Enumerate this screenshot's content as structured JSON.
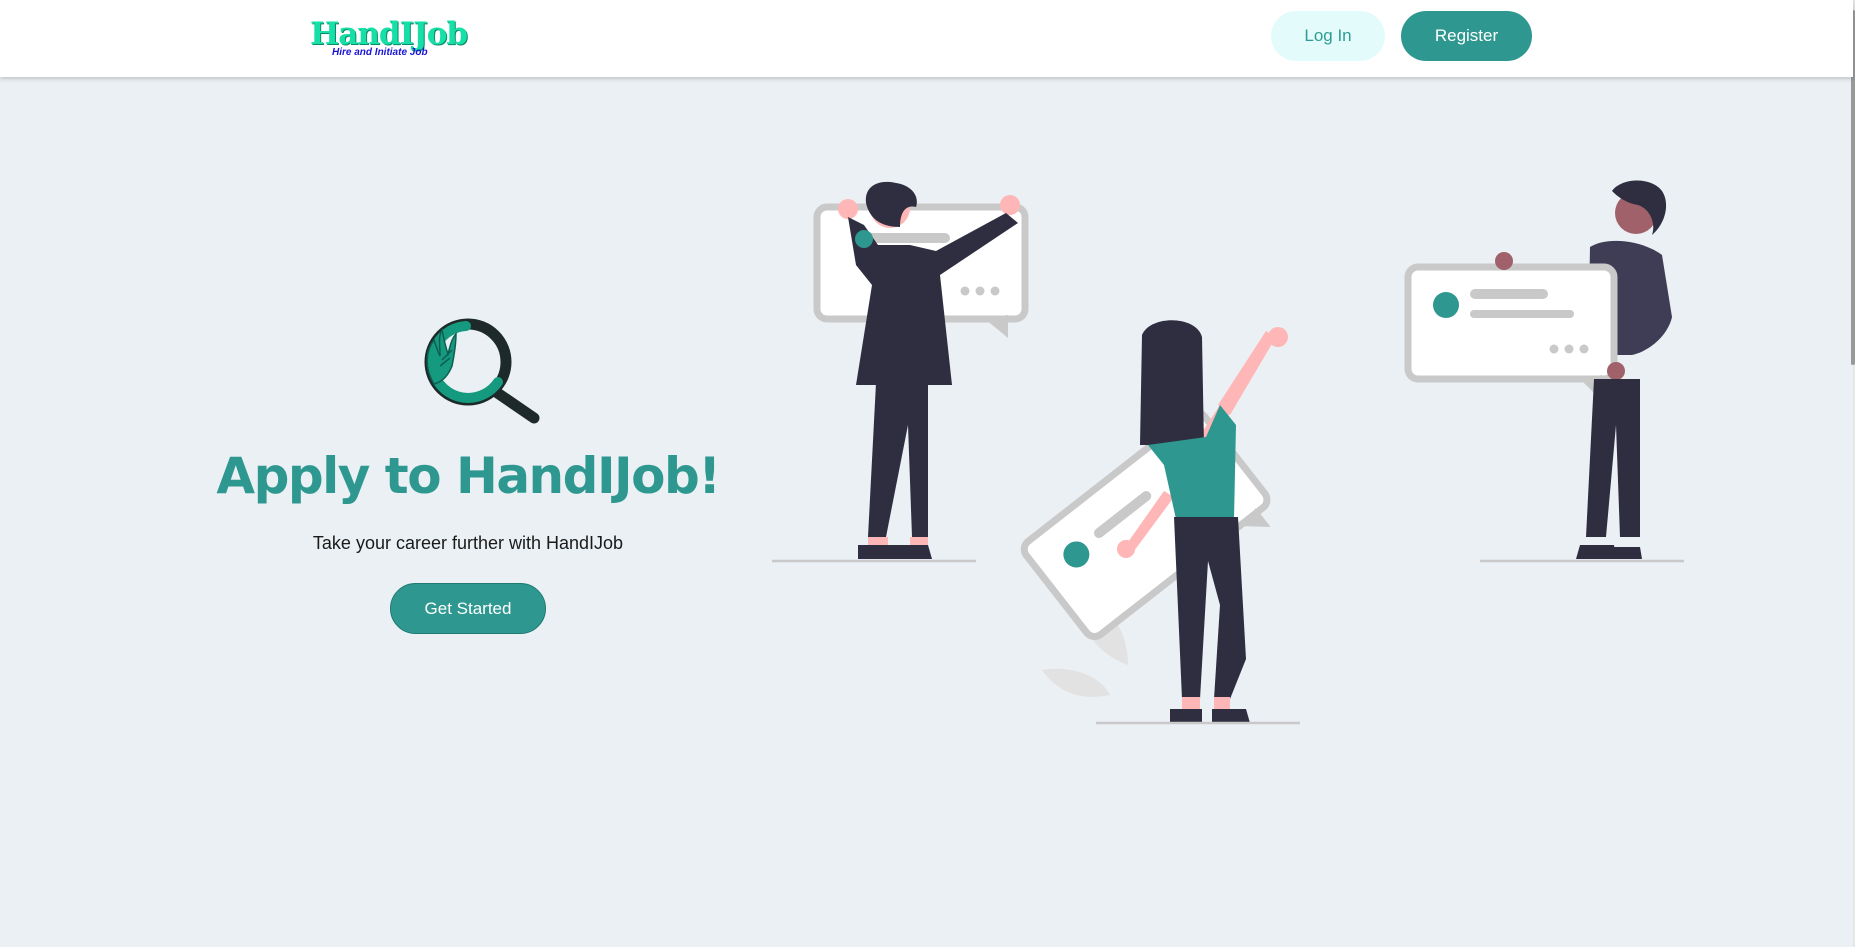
{
  "navbar": {
    "logo_title": "HandIJob",
    "logo_subtitle": "Hire and Initiate Job",
    "login_label": "Log In",
    "register_label": "Register"
  },
  "hero": {
    "heading": "Apply to HandIJob!",
    "subtitle": "Take your career further with HandIJob",
    "cta_label": "Get Started"
  },
  "colors": {
    "accent": "#2e9890",
    "logo_green": "#16e0a8",
    "logo_blue": "#1a14d8",
    "background": "#ebf0f4",
    "login_bg": "#e4fbfb"
  },
  "icons": [
    "hand-magnifier-logo-icon"
  ]
}
